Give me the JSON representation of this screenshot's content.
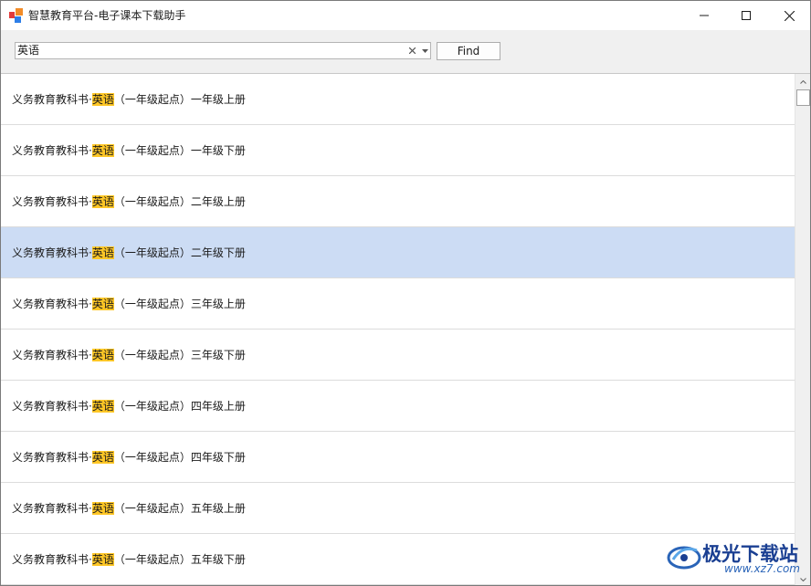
{
  "window": {
    "title": "智慧教育平台-电子课本下载助手"
  },
  "toolbar": {
    "search_value": "英语",
    "find_label": "Find"
  },
  "list": {
    "items": [
      {
        "prefix": "义务教育教科书·",
        "highlight": "英语",
        "suffix": "（一年级起点）一年级上册",
        "selected": false
      },
      {
        "prefix": "义务教育教科书·",
        "highlight": "英语",
        "suffix": "（一年级起点）一年级下册",
        "selected": false
      },
      {
        "prefix": "义务教育教科书·",
        "highlight": "英语",
        "suffix": "（一年级起点）二年级上册",
        "selected": false
      },
      {
        "prefix": "义务教育教科书·",
        "highlight": "英语",
        "suffix": "（一年级起点）二年级下册",
        "selected": true
      },
      {
        "prefix": "义务教育教科书·",
        "highlight": "英语",
        "suffix": "（一年级起点）三年级上册",
        "selected": false
      },
      {
        "prefix": "义务教育教科书·",
        "highlight": "英语",
        "suffix": "（一年级起点）三年级下册",
        "selected": false
      },
      {
        "prefix": "义务教育教科书·",
        "highlight": "英语",
        "suffix": "（一年级起点）四年级上册",
        "selected": false
      },
      {
        "prefix": "义务教育教科书·",
        "highlight": "英语",
        "suffix": "（一年级起点）四年级下册",
        "selected": false
      },
      {
        "prefix": "义务教育教科书·",
        "highlight": "英语",
        "suffix": "（一年级起点）五年级上册",
        "selected": false
      },
      {
        "prefix": "义务教育教科书·",
        "highlight": "英语",
        "suffix": "（一年级起点）五年级下册",
        "selected": false
      }
    ]
  },
  "watermark": {
    "name": "极光下载站",
    "url": "www.xz7.com"
  },
  "colors": {
    "selected_row": "#ccdcf4",
    "highlight": "#ffc726",
    "watermark": "#1a3f92"
  }
}
